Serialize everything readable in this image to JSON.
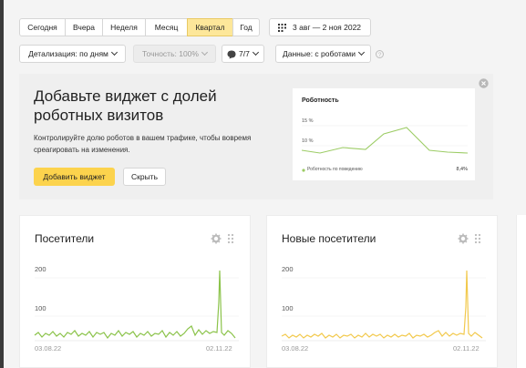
{
  "period_tabs": [
    "Сегодня",
    "Вчера",
    "Неделя",
    "Месяц",
    "Квартал",
    "Год"
  ],
  "date_range": "3 авг — 2 ноя 2022",
  "filters": {
    "detail": "Детализация: по дням",
    "accuracy": "Точность: 100%",
    "segments": "7/7",
    "data": "Данные: с роботами"
  },
  "promo": {
    "title_line1": "Добавьте виджет с долей",
    "title_line2": "роботных визитов",
    "text_line1": "Контролируйте долю роботов в вашем трафике, чтобы вовремя",
    "text_line2": "среагировать на изменения.",
    "add_button": "Добавить виджет",
    "hide_button": "Скрыть",
    "preview": {
      "title": "Роботность",
      "y_label_top": "15 %",
      "y_label_mid": "10 %",
      "legend": "Роботность по поведению",
      "value": "8,4%"
    }
  },
  "widgets": [
    {
      "title": "Посетители",
      "y_top": "200",
      "y_mid": "100",
      "x_start": "03.08.22",
      "x_end": "02.11.22",
      "color": "#8bc34a"
    },
    {
      "title": "Новые посетители",
      "y_top": "200",
      "y_mid": "100",
      "x_start": "03.08.22",
      "x_end": "02.11.22",
      "color": "#f2c94c"
    }
  ],
  "colors": {
    "accent": "#fcd34d",
    "active_tab": "#fde79a",
    "visitors_line": "#8bc34a",
    "new_visitors_line": "#f2c94c"
  }
}
